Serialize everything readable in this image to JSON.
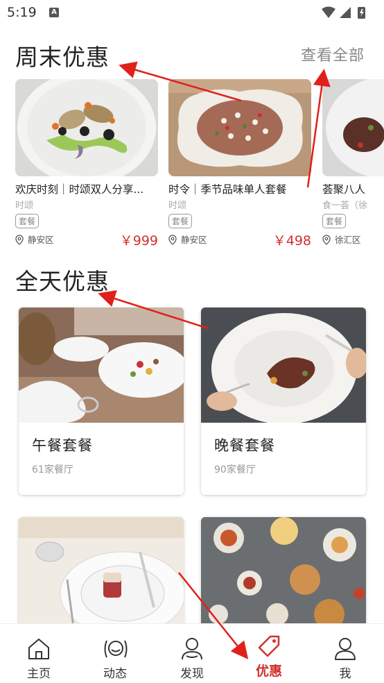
{
  "status": {
    "time": "5:19",
    "a_glyph": "A"
  },
  "weekend": {
    "title": "周末优惠",
    "see_all": "查看全部",
    "items": [
      {
        "name": "欢庆时刻｜时颂双人分享...",
        "brand": "时颂",
        "tag": "套餐",
        "district": "静安区",
        "price": "￥999"
      },
      {
        "name": "时令｜季节品味单人套餐",
        "brand": "时颂",
        "tag": "套餐",
        "district": "静安区",
        "price": "￥498"
      },
      {
        "name": "荟聚八人",
        "brand": "食一荟（徐",
        "tag": "套餐",
        "district": "徐汇区",
        "price": ""
      }
    ]
  },
  "allday": {
    "title": "全天优惠",
    "items": [
      {
        "title": "午餐套餐",
        "count": "61家餐厅"
      },
      {
        "title": "晚餐套餐",
        "count": "90家餐厅"
      },
      {
        "title": "",
        "count": ""
      },
      {
        "title": "",
        "count": ""
      }
    ]
  },
  "tabs": [
    {
      "label": "主页",
      "icon": "home-icon"
    },
    {
      "label": "动态",
      "icon": "chat-icon"
    },
    {
      "label": "发现",
      "icon": "user-discover-icon"
    },
    {
      "label": "优惠",
      "icon": "tag-icon",
      "active": true
    },
    {
      "label": "我",
      "icon": "profile-icon"
    }
  ],
  "colors": {
    "accent": "#d0312d",
    "annotation": "#e0201a"
  }
}
